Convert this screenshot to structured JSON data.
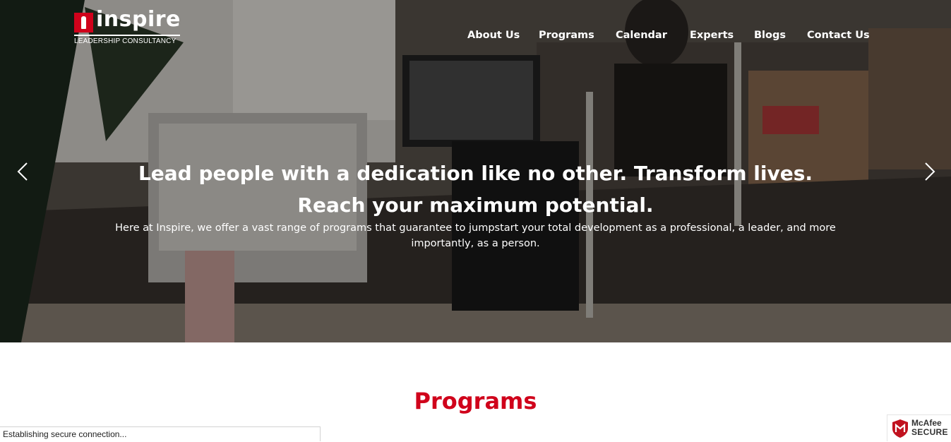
{
  "header": {
    "logo": {
      "wordmark": "inspire",
      "tagline": "LEADERSHIP CONSULTANCY",
      "brand_color": "#d0021b"
    },
    "nav": [
      {
        "label": "About Us"
      },
      {
        "label": "Programs"
      },
      {
        "label": "Calendar"
      },
      {
        "label": "Experts"
      },
      {
        "label": "Blogs"
      },
      {
        "label": "Contact Us"
      }
    ]
  },
  "hero": {
    "headline": "Lead people with a dedication like no other. Transform lives. Reach your maximum potential.",
    "subtext": "Here at Inspire, we offer a vast range of programs that guarantee to jumpstart your total development as a professional, a leader, and more importantly, as a person.",
    "prev_icon": "chevron-left-icon",
    "next_icon": "chevron-right-icon"
  },
  "programs": {
    "title": "Programs",
    "title_color": "#d0021b"
  },
  "browser_status": {
    "text": "Establishing secure connection..."
  },
  "mcafee_badge": {
    "brand": "McAfee",
    "label": "SECURE",
    "icon": "mcafee-shield-icon",
    "color": "#c1121f"
  }
}
